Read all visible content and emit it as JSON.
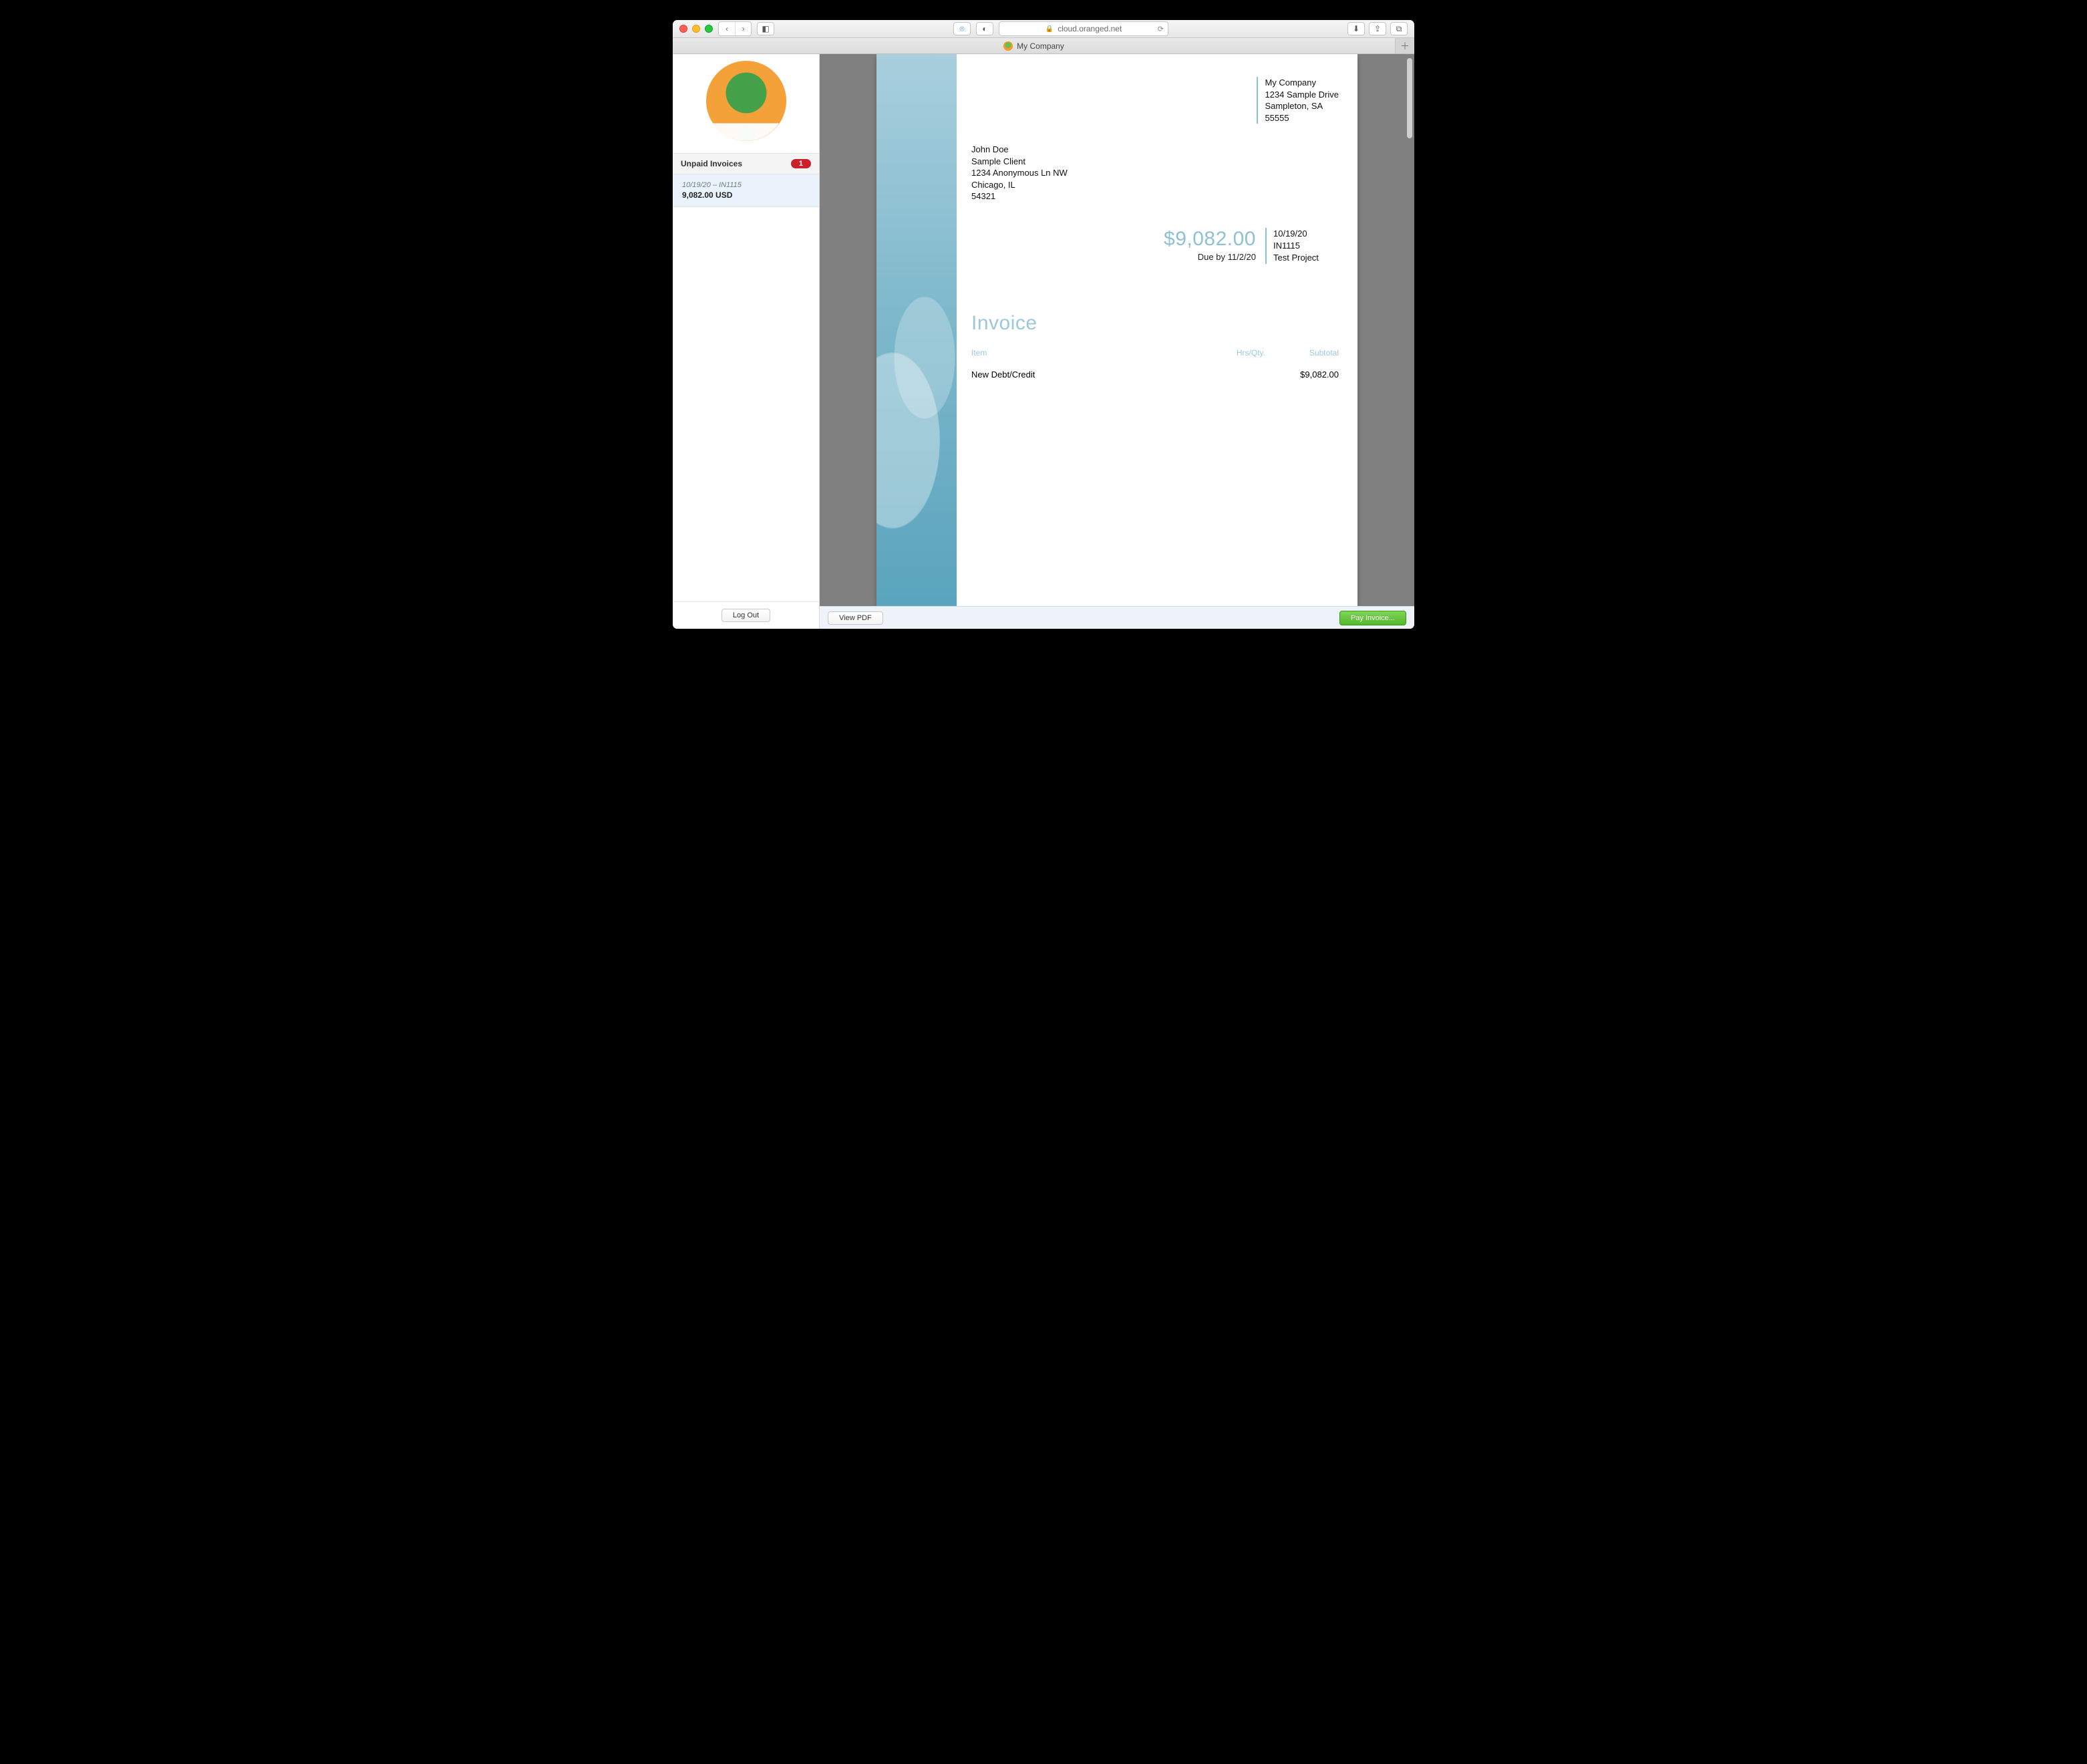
{
  "browser": {
    "url_host": "cloud.oranged.net",
    "tab_title": "My Company"
  },
  "sidebar": {
    "section_title": "Unpaid Invoices",
    "badge_count": "1",
    "items": [
      {
        "meta": "10/19/20 – IN1115",
        "amount": "9,082.00 USD"
      }
    ],
    "logout_label": "Log Out"
  },
  "footer": {
    "view_pdf_label": "View PDF",
    "pay_label": "Pay Invoice..."
  },
  "invoice": {
    "company": {
      "name": "My Company",
      "street": "1234 Sample Drive",
      "city_state": "Sampleton, SA",
      "zip": "55555"
    },
    "client": {
      "name": "John Doe",
      "org": "Sample Client",
      "street": "1234 Anonymous Ln NW",
      "city_state": "Chicago, IL",
      "zip": "54321"
    },
    "total_display": "$9,082.00",
    "due_by": "Due by 11/2/20",
    "meta": {
      "date": "10/19/20",
      "number": "IN1115",
      "project": "Test Project"
    },
    "title": "Invoice",
    "columns": {
      "item": "Item",
      "qty": "Hrs/Qty.",
      "subtotal": "Subtotal"
    },
    "lines": [
      {
        "item": "New Debt/Credit",
        "qty": "",
        "subtotal": "$9,082.00"
      }
    ]
  }
}
